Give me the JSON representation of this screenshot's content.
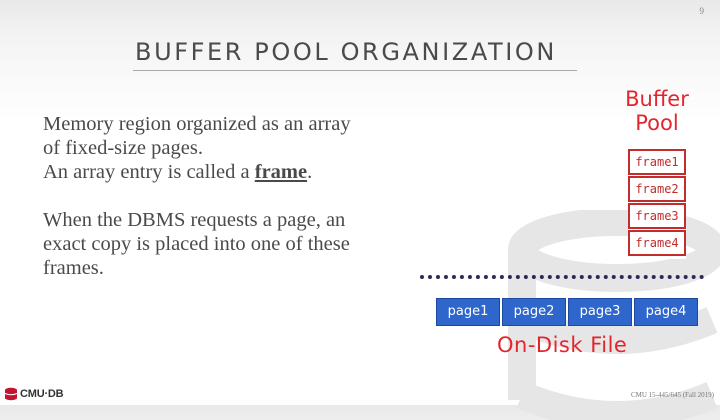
{
  "slide": {
    "number": "9",
    "title": "BUFFER POOL ORGANIZATION"
  },
  "body": {
    "para1_line1": "Memory region organized as an array",
    "para1_line2": "of fixed-size pages.",
    "para1_line3_prefix": "An array entry is called a ",
    "para1_line3_bold": "frame",
    "para1_line3_suffix": ".",
    "para2_line1": "When the DBMS requests a page, an",
    "para2_line2": "exact copy is placed into one of these",
    "para2_line3": "frames."
  },
  "diagram": {
    "buffer_pool_line1": "Buffer",
    "buffer_pool_line2": "Pool",
    "frames": [
      "frame1",
      "frame2",
      "frame3",
      "frame4"
    ],
    "pages": [
      "page1",
      "page2",
      "page3",
      "page4"
    ],
    "disk_label": "On-Disk File"
  },
  "footer": {
    "logo_text": "CMU·DB",
    "course": "CMU 15-445/645 (Fall 2019)"
  },
  "colors": {
    "accent_red": "#e3262e",
    "frame_border": "#c22c2c",
    "page_blue": "#2e66cc",
    "logo_red": "#c41230"
  }
}
